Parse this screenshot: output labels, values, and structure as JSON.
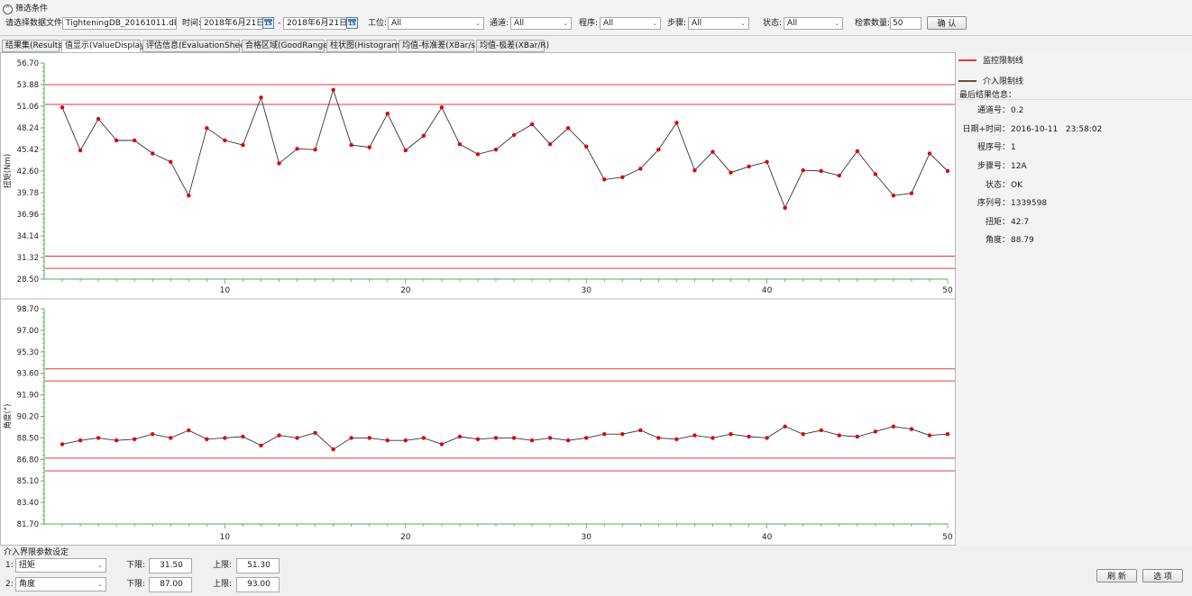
{
  "filter": {
    "title": "筛选条件",
    "db_label": "请选择数据文件:",
    "db_value": "TighteningDB_20161011.db",
    "time_label": "时间:",
    "date_from": "2018年6月21日",
    "date_sep": "-",
    "date_to": "2018年6月21日",
    "calendar_day": "15",
    "station_label": "工位:",
    "station_value": "All",
    "channel_label": "通道:",
    "channel_value": "All",
    "program_label": "程序:",
    "program_value": "All",
    "step_label": "步骤:",
    "step_value": "All",
    "status_label": "状态:",
    "status_value": "All",
    "count_label": "检索数量:",
    "count_value": "50",
    "confirm_label": "确 认"
  },
  "tabs": [
    {
      "label": "结果集(Results)",
      "active": false
    },
    {
      "label": "值显示(ValueDisplay)",
      "active": true
    },
    {
      "label": "评估信息(EvaluationSheet)",
      "active": false
    },
    {
      "label": "合格区域(GoodRange)",
      "active": false
    },
    {
      "label": "柱状图(Histogram)",
      "active": false
    },
    {
      "label": "均值-标准差(XBar/s)",
      "active": false
    },
    {
      "label": "均值-极差(XBar/R)",
      "active": false
    }
  ],
  "legend": {
    "monitor_label": "监控限制线",
    "monitor_color": "#e23b3b",
    "intervene_label": "介入限制线",
    "intervene_color": "#7a4a2a"
  },
  "last_result": {
    "title": "最后结果信息：",
    "rows": [
      {
        "label": "通道号：",
        "value": "0.2"
      },
      {
        "label": "日期+时间：",
        "value": "2016-10-11   23:58:02"
      },
      {
        "label": "程序号：",
        "value": "1"
      },
      {
        "label": "步骤号：",
        "value": "12A"
      },
      {
        "label": "状态：",
        "value": "OK"
      },
      {
        "label": "序列号：",
        "value": "1339598"
      },
      {
        "label": "扭矩：",
        "value": "42.7"
      },
      {
        "label": "角度：",
        "value": "88.79"
      }
    ]
  },
  "chart_data": [
    {
      "type": "line",
      "ylabel": "扭矩(Nm)",
      "ylim": [
        28.5,
        56.7
      ],
      "yticks": [
        "56.70",
        "53.88",
        "51.06",
        "48.24",
        "45.42",
        "42.60",
        "39.78",
        "36.96",
        "34.14",
        "31.32",
        "28.50"
      ],
      "xlim": [
        0,
        50
      ],
      "xticks": [
        10,
        20,
        30,
        40,
        50
      ],
      "limit_lines": [
        53.88,
        51.3,
        31.5,
        29.9
      ],
      "x": [
        1,
        2,
        3,
        4,
        5,
        6,
        7,
        8,
        9,
        10,
        11,
        12,
        13,
        14,
        15,
        16,
        17,
        18,
        19,
        20,
        21,
        22,
        23,
        24,
        25,
        26,
        27,
        28,
        29,
        30,
        31,
        32,
        33,
        34,
        35,
        36,
        37,
        38,
        39,
        40,
        41,
        42,
        43,
        44,
        45,
        46,
        47,
        48,
        49,
        50
      ],
      "values": [
        50.9,
        45.3,
        49.4,
        46.6,
        46.6,
        44.9,
        43.8,
        39.4,
        48.2,
        46.6,
        46.0,
        52.2,
        43.6,
        45.5,
        45.4,
        53.2,
        46.0,
        45.7,
        50.1,
        45.3,
        47.2,
        50.9,
        46.1,
        44.8,
        45.4,
        47.3,
        48.7,
        46.1,
        48.2,
        45.8,
        41.5,
        41.8,
        42.9,
        45.4,
        48.9,
        42.7,
        45.1,
        42.4,
        43.2,
        43.8,
        37.8,
        42.7,
        42.6,
        42.0,
        45.2,
        42.2,
        39.4,
        39.7,
        44.9,
        42.6
      ],
      "line_color": "#333333",
      "point_color": "#e00000"
    },
    {
      "type": "line",
      "ylabel": "角度(°)",
      "ylim": [
        81.7,
        98.7
      ],
      "yticks": [
        "98.70",
        "97.00",
        "95.30",
        "93.60",
        "91.90",
        "90.20",
        "88.50",
        "86.80",
        "85.10",
        "83.40",
        "81.70"
      ],
      "xlim": [
        0,
        50
      ],
      "xticks": [
        10,
        20,
        30,
        40,
        50
      ],
      "limit_lines": [
        93.95,
        93.0,
        86.9,
        85.9
      ],
      "x": [
        1,
        2,
        3,
        4,
        5,
        6,
        7,
        8,
        9,
        10,
        11,
        12,
        13,
        14,
        15,
        16,
        17,
        18,
        19,
        20,
        21,
        22,
        23,
        24,
        25,
        26,
        27,
        28,
        29,
        30,
        31,
        32,
        33,
        34,
        35,
        36,
        37,
        38,
        39,
        40,
        41,
        42,
        43,
        44,
        45,
        46,
        47,
        48,
        49,
        50
      ],
      "values": [
        88.0,
        88.3,
        88.5,
        88.3,
        88.4,
        88.8,
        88.5,
        89.1,
        88.4,
        88.5,
        88.6,
        87.9,
        88.7,
        88.5,
        88.9,
        87.6,
        88.5,
        88.5,
        88.3,
        88.3,
        88.5,
        88.0,
        88.6,
        88.4,
        88.5,
        88.5,
        88.3,
        88.5,
        88.3,
        88.5,
        88.8,
        88.8,
        89.1,
        88.5,
        88.4,
        88.7,
        88.5,
        88.8,
        88.6,
        88.5,
        89.4,
        88.8,
        89.1,
        88.7,
        88.6,
        89.0,
        89.4,
        89.2,
        88.7,
        88.8
      ],
      "line_color": "#333333",
      "point_color": "#e00000"
    }
  ],
  "intervene_settings": {
    "title": "介入界限参数设定",
    "rows": [
      {
        "index": "1:",
        "select": "扭矩",
        "lower_label": "下限:",
        "lower": "31.50",
        "upper_label": "上限:",
        "upper": "51.30"
      },
      {
        "index": "2:",
        "select": "角度",
        "lower_label": "下限:",
        "lower": "87.00",
        "upper_label": "上限:",
        "upper": "93.00"
      }
    ]
  },
  "actions": {
    "refresh_label": "刷 新",
    "options_label": "选 项"
  }
}
